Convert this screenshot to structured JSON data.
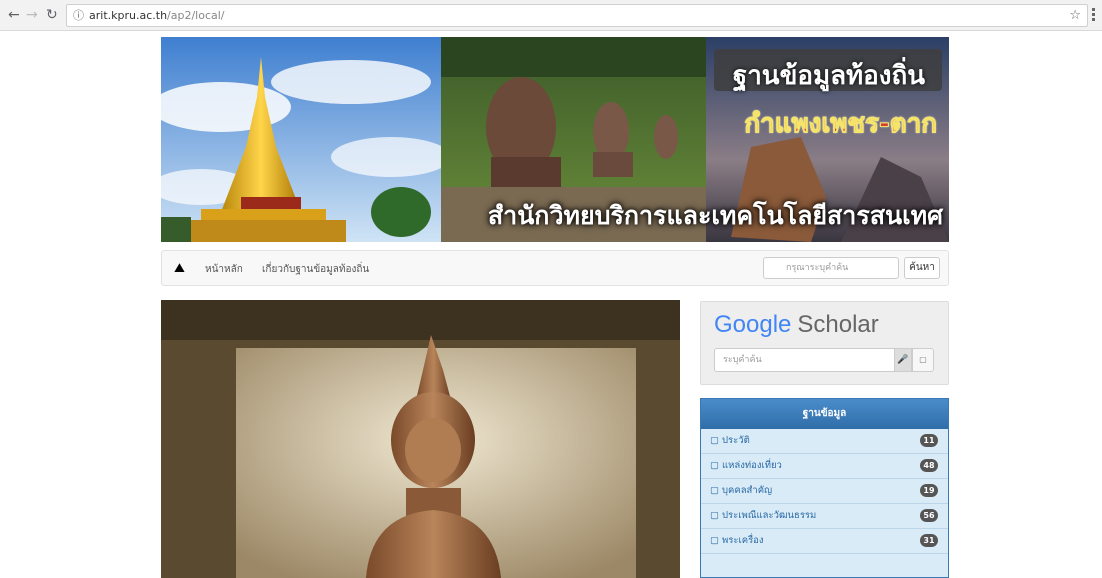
{
  "browser": {
    "host": "arit.kpru.ac.th",
    "path": "/ap2/local/"
  },
  "banner": {
    "title": "ฐานข้อมูลท้องถิ่น",
    "subtitle": "กำแพงเพชร-ตาก",
    "org": "สำนักวิทยบริการและเทคโนโลยีสารสนเทศ"
  },
  "nav": {
    "home": "หน้าหลัก",
    "about": "เกี่ยวกับฐานข้อมูลท้องถิ่น",
    "search_placeholder": "กรุณาระบุคำค้น",
    "search_button": "ค้นหา"
  },
  "scholar": {
    "logo_google": "Google",
    "logo_scholar": "Scholar",
    "placeholder": "ระบุคำค้น"
  },
  "panel": {
    "title": "ฐานข้อมูล",
    "items": [
      {
        "label": "ประวัติ",
        "count": "11"
      },
      {
        "label": "แหล่งท่องเที่ยว",
        "count": "48"
      },
      {
        "label": "บุคคลสำคัญ",
        "count": "19"
      },
      {
        "label": "ประเพณีและวัฒนธรรม",
        "count": "56"
      },
      {
        "label": "พระเครื่อง",
        "count": "31"
      }
    ]
  },
  "colors": {
    "panel_header": "#3b78b3",
    "panel_body": "#d9ebf7",
    "badge": "#555555"
  }
}
